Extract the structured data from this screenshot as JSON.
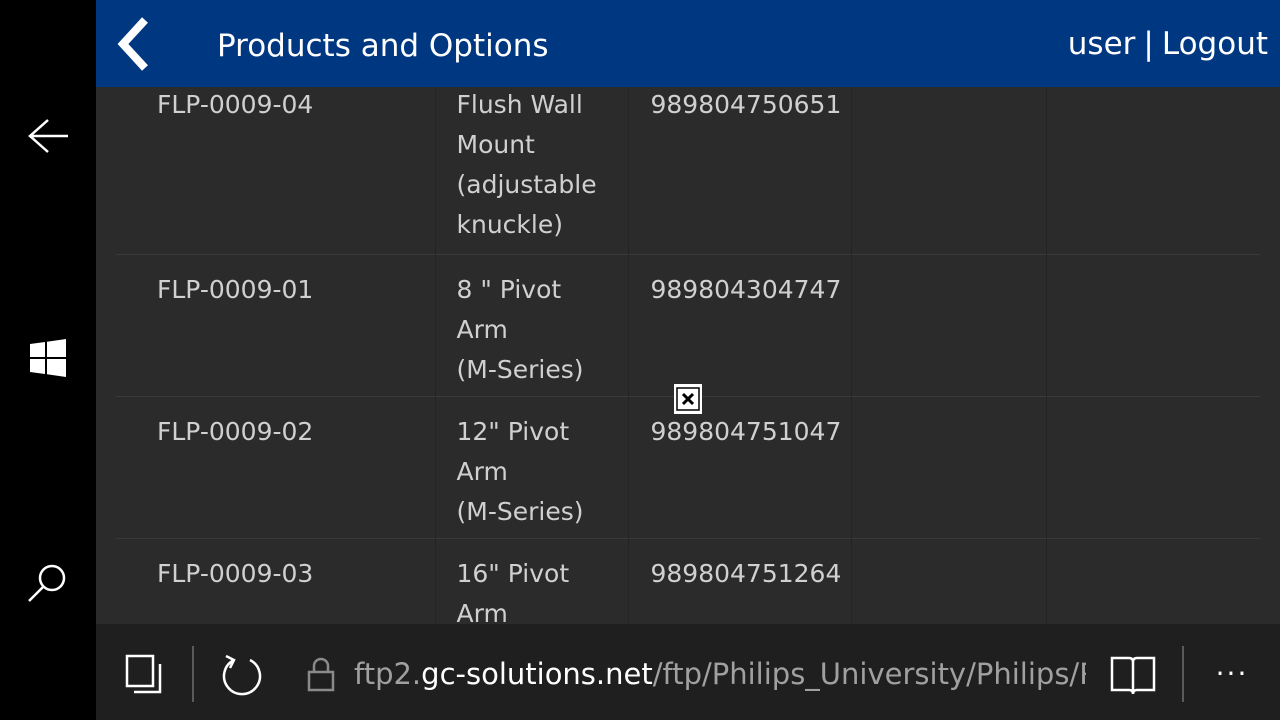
{
  "header": {
    "title": "Products and Options",
    "user": "user",
    "separator": "|",
    "logout": "Logout",
    "background_color": "#003781"
  },
  "table": {
    "rows": [
      {
        "part_number": "FLP-0009-04",
        "description_lines": [
          "Flush Wall",
          "Mount",
          "(adjustable",
          "knuckle)"
        ],
        "code": "989804750651",
        "col4": "",
        "col5": ""
      },
      {
        "part_number": "FLP-0009-01",
        "description_lines": [
          "8 \" Pivot",
          "Arm",
          "(M-Series)"
        ],
        "code": "989804304747",
        "col4": "",
        "col5": ""
      },
      {
        "part_number": "FLP-0009-02",
        "description_lines": [
          "12\" Pivot",
          "Arm",
          "(M-Series)"
        ],
        "code": "989804751047",
        "col4": "",
        "col5": ""
      },
      {
        "part_number": "FLP-0009-03",
        "description_lines": [
          "16\" Pivot",
          "Arm"
        ],
        "code": "989804751264",
        "col4": "",
        "col5": ""
      }
    ]
  },
  "browser": {
    "url_prefix": "ftp2.",
    "url_domain": "gc-solutions.net",
    "url_path": "/ftp/Philips_University/Philips/Row_",
    "more_label": "···"
  },
  "icons": {
    "system_back": "arrow-left-icon",
    "system_start": "windows-logo-icon",
    "system_search": "search-icon",
    "header_back": "chevron-left-icon",
    "broken_image": "broken-image-icon",
    "tabs": "tabs-icon",
    "refresh": "refresh-icon",
    "lock": "lock-icon",
    "reading_view": "reading-view-icon",
    "more": "more-icon"
  }
}
